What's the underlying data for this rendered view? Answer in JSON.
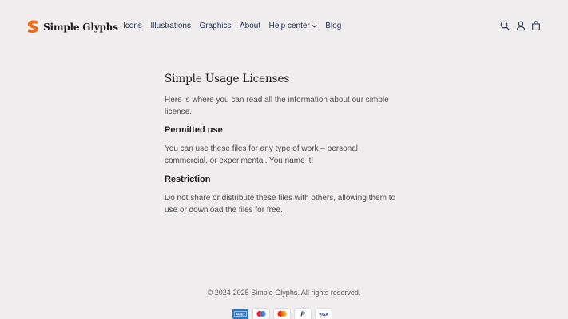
{
  "brand": {
    "name": "Simple Glyphs",
    "logo_icon": "s-logo-icon",
    "accent_color": "#f26a1b"
  },
  "nav": {
    "items": [
      {
        "label": "Icons"
      },
      {
        "label": "Illustrations"
      },
      {
        "label": "Graphics"
      },
      {
        "label": "About"
      },
      {
        "label": "Help center",
        "has_dropdown": true
      },
      {
        "label": "Blog"
      }
    ]
  },
  "header_icons": [
    "search-icon",
    "account-icon",
    "cart-icon"
  ],
  "page": {
    "title": "Simple Usage Licenses",
    "intro": "Here is where you can read all the information about our simple license.",
    "sections": [
      {
        "heading": "Permitted use",
        "body": "You can use these files for any type of work – personal, commercial, or experimental. You name it!"
      },
      {
        "heading": "Restriction",
        "body": "Do not share or distribute these files with others, allowing them to use or download the files for free."
      }
    ]
  },
  "footer": {
    "copyright": "© 2024-2025 Simple Glyphs. All rights reserved.",
    "payment_methods": [
      {
        "name": "American Express",
        "icon": "amex-icon",
        "label": "AMEX"
      },
      {
        "name": "Maestro",
        "icon": "maestro-icon"
      },
      {
        "name": "Mastercard",
        "icon": "mastercard-icon"
      },
      {
        "name": "PayPal",
        "icon": "paypal-icon",
        "label": "P"
      },
      {
        "name": "Visa",
        "icon": "visa-icon",
        "label": "VISA"
      }
    ]
  }
}
